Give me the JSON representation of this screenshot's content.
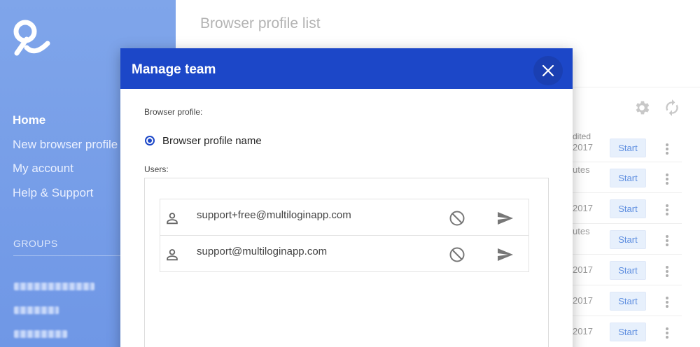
{
  "sidebar": {
    "nav": [
      {
        "label": "Home",
        "active": true
      },
      {
        "label": "New browser profile",
        "active": false
      },
      {
        "label": "My account",
        "active": false
      },
      {
        "label": "Help & Support",
        "active": false
      }
    ],
    "groups_label": "GROUPS"
  },
  "main": {
    "title": "Browser profile list",
    "column_header": "dited",
    "rows": [
      {
        "text": "2017",
        "button": "Start"
      },
      {
        "text": "utes",
        "button": "Start"
      },
      {
        "text": "2017",
        "button": "Start"
      },
      {
        "text": "utes",
        "button": "Start"
      },
      {
        "text": "2017",
        "button": "Start"
      },
      {
        "text": "2017",
        "button": "Start"
      },
      {
        "text": "2017",
        "button": "Start"
      }
    ]
  },
  "modal": {
    "title": "Manage team",
    "browser_profile_label": "Browser profile:",
    "profile_name": "Browser profile name",
    "users_label": "Users:",
    "users": [
      {
        "email": "support+free@multiloginapp.com"
      },
      {
        "email": "support@multiloginapp.com"
      }
    ]
  },
  "colors": {
    "sidebar": "#7fa5ea",
    "modal_header": "#1c47c8",
    "start_button_bg": "#e7f0fc",
    "start_button_text": "#5f8fe0"
  },
  "icons": [
    "logo-icon",
    "settings-icon",
    "refresh-icon",
    "close-icon",
    "person-icon",
    "block-icon",
    "send-icon",
    "more-vert-icon"
  ]
}
